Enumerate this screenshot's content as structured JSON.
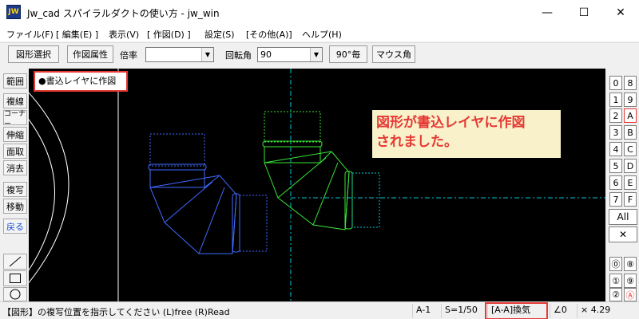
{
  "window": {
    "icon_text": "JW",
    "title": "Jw_cad スパイラルダクトの使い方 - jw_win",
    "minimize_glyph": "—",
    "maximize_glyph": "☐",
    "close_glyph": "✕"
  },
  "menu": {
    "items": [
      "ファイル(F)",
      "[ 編集(E) ]",
      "表示(V)",
      "[ 作図(D) ]",
      "設定(S)",
      "[その他(A)]",
      "ヘルプ(H)"
    ]
  },
  "toolbar": {
    "select_shape": "図形選択",
    "draw_attr": "作図属性",
    "scale_label": "倍率",
    "scale_value": "",
    "rotation_label": "回転角",
    "rotation_value": "90",
    "deg90": "90°毎",
    "mouse_angle": "マウス角"
  },
  "left_tools": [
    "範囲",
    "複線",
    "コーナー",
    "伸縮",
    "面取",
    "消去",
    "複写",
    "移動",
    "戻る"
  ],
  "left_shapes": [
    "line-tool-icon",
    "rectangle-tool-icon",
    "circle-tool-icon"
  ],
  "canvas": {
    "layer_label": "●書込レイヤに作図",
    "callout_line1": "図形が書込レイヤに作図",
    "callout_line2": "されました。"
  },
  "right_layers": {
    "rows": [
      [
        "0",
        "8"
      ],
      [
        "1",
        "9"
      ],
      [
        "2",
        "A"
      ],
      [
        "3",
        "B"
      ],
      [
        "4",
        "C"
      ],
      [
        "5",
        "D"
      ],
      [
        "6",
        "E"
      ],
      [
        "7",
        "F"
      ]
    ],
    "all": "All",
    "close_glyph": "✕",
    "circle_rows": [
      [
        "⓪",
        "⑧"
      ],
      [
        "①",
        "⑨"
      ],
      [
        "②",
        "Ⓐ"
      ]
    ]
  },
  "status": {
    "message": "【図形】の複写位置を指示してください (L)free (R)Read",
    "layer": "A-1",
    "scale": "S=1/50",
    "layer_switch": "[A-A]換気",
    "angle": "∠0",
    "zoom": "× 4.29"
  },
  "colors": {
    "blue_duct": "#3f6bff",
    "green_duct": "#39e639",
    "cyan_guide": "#00c8d8",
    "highlight": "#e53935"
  }
}
